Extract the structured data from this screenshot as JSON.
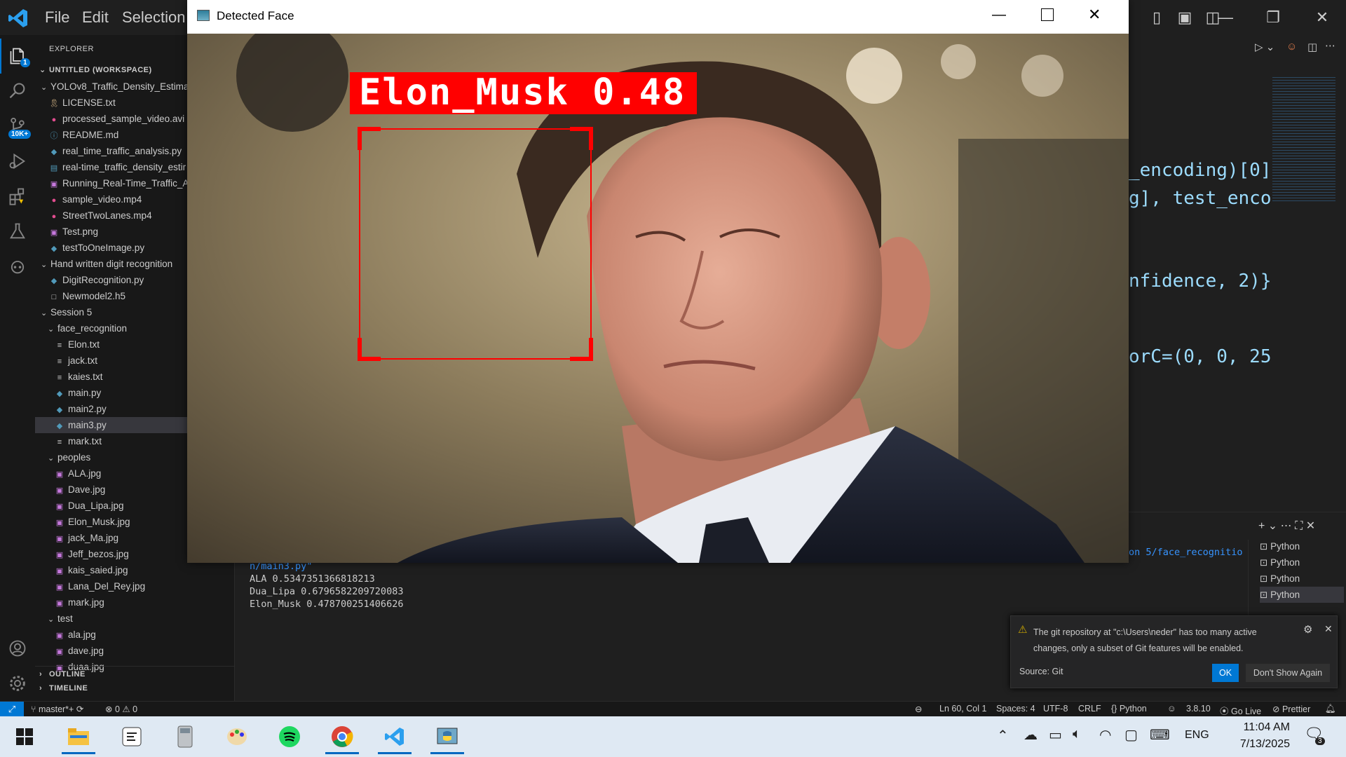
{
  "app_title": "Visual Studio Code",
  "menu": [
    "File",
    "Edit",
    "Selection"
  ],
  "sidebar": {
    "explorer_label": "EXPLORER",
    "workspace_label": "UNTITLED (WORKSPACE)",
    "items": [
      {
        "label": "YOLOv8_Traffic_Density_Estima",
        "type": "folder",
        "depth": 1,
        "icon": "chevron-down-icon"
      },
      {
        "label": "LICENSE.txt",
        "type": "file",
        "depth": 2,
        "icon": "license-icon",
        "color": "#e2c08d"
      },
      {
        "label": "processed_sample_video.avi",
        "type": "file",
        "depth": 2,
        "icon": "video-icon",
        "color": "#e24d8f"
      },
      {
        "label": "README.md",
        "type": "file",
        "depth": 2,
        "icon": "info-icon",
        "color": "#519aba"
      },
      {
        "label": "real_time_traffic_analysis.py",
        "type": "file",
        "depth": 2,
        "icon": "python-icon",
        "color": "#519aba"
      },
      {
        "label": "real-time_traffic_density_estir",
        "type": "file",
        "depth": 2,
        "icon": "notebook-icon",
        "color": "#519aba"
      },
      {
        "label": "Running_Real-Time_Traffic_A",
        "type": "file",
        "depth": 2,
        "icon": "image-icon",
        "color": "#c678dd"
      },
      {
        "label": "sample_video.mp4",
        "type": "file",
        "depth": 2,
        "icon": "video-icon",
        "color": "#e24d8f"
      },
      {
        "label": "StreetTwoLanes.mp4",
        "type": "file",
        "depth": 2,
        "icon": "video-icon",
        "color": "#e24d8f"
      },
      {
        "label": "Test.png",
        "type": "file",
        "depth": 2,
        "icon": "image-icon",
        "color": "#c678dd"
      },
      {
        "label": "testToOneImage.py",
        "type": "file",
        "depth": 2,
        "icon": "python-icon",
        "color": "#519aba"
      },
      {
        "label": "Hand written digit recognition",
        "type": "folder",
        "depth": 1,
        "icon": "chevron-down-icon"
      },
      {
        "label": "DigitRecognition.py",
        "type": "file",
        "depth": 2,
        "icon": "python-icon",
        "color": "#519aba"
      },
      {
        "label": "Newmodel2.h5",
        "type": "file",
        "depth": 2,
        "icon": "blank-icon",
        "color": "#cccccc"
      },
      {
        "label": "Session 5",
        "type": "folder",
        "depth": 1,
        "icon": "chevron-down-icon"
      },
      {
        "label": "face_recognition",
        "type": "folder",
        "depth": 2,
        "icon": "chevron-down-icon"
      },
      {
        "label": "Elon.txt",
        "type": "file",
        "depth": 3,
        "icon": "lines-icon",
        "color": "#cccccc"
      },
      {
        "label": "jack.txt",
        "type": "file",
        "depth": 3,
        "icon": "lines-icon",
        "color": "#cccccc"
      },
      {
        "label": "kaies.txt",
        "type": "file",
        "depth": 3,
        "icon": "lines-icon",
        "color": "#cccccc"
      },
      {
        "label": "main.py",
        "type": "file",
        "depth": 3,
        "icon": "python-icon",
        "color": "#519aba"
      },
      {
        "label": "main2.py",
        "type": "file",
        "depth": 3,
        "icon": "python-icon",
        "color": "#519aba"
      },
      {
        "label": "main3.py",
        "type": "file",
        "depth": 3,
        "icon": "python-icon",
        "color": "#519aba",
        "selected": true
      },
      {
        "label": "mark.txt",
        "type": "file",
        "depth": 3,
        "icon": "lines-icon",
        "color": "#cccccc"
      },
      {
        "label": "peoples",
        "type": "folder",
        "depth": 2,
        "icon": "chevron-down-icon"
      },
      {
        "label": "ALA.jpg",
        "type": "file",
        "depth": 3,
        "icon": "image-icon",
        "color": "#c678dd"
      },
      {
        "label": "Dave.jpg",
        "type": "file",
        "depth": 3,
        "icon": "image-icon",
        "color": "#c678dd"
      },
      {
        "label": "Dua_Lipa.jpg",
        "type": "file",
        "depth": 3,
        "icon": "image-icon",
        "color": "#c678dd"
      },
      {
        "label": "Elon_Musk.jpg",
        "type": "file",
        "depth": 3,
        "icon": "image-icon",
        "color": "#c678dd"
      },
      {
        "label": "jack_Ma.jpg",
        "type": "file",
        "depth": 3,
        "icon": "image-icon",
        "color": "#c678dd"
      },
      {
        "label": "Jeff_bezos.jpg",
        "type": "file",
        "depth": 3,
        "icon": "image-icon",
        "color": "#c678dd"
      },
      {
        "label": "kais_saied.jpg",
        "type": "file",
        "depth": 3,
        "icon": "image-icon",
        "color": "#c678dd"
      },
      {
        "label": "Lana_Del_Rey.jpg",
        "type": "file",
        "depth": 3,
        "icon": "image-icon",
        "color": "#c678dd"
      },
      {
        "label": "mark.jpg",
        "type": "file",
        "depth": 3,
        "icon": "image-icon",
        "color": "#c678dd"
      },
      {
        "label": "test",
        "type": "folder",
        "depth": 2,
        "icon": "chevron-down-icon"
      },
      {
        "label": "ala.jpg",
        "type": "file",
        "depth": 3,
        "icon": "image-icon",
        "color": "#c678dd"
      },
      {
        "label": "dave.jpg",
        "type": "file",
        "depth": 3,
        "icon": "image-icon",
        "color": "#c678dd"
      },
      {
        "label": "duaa.jpg",
        "type": "file",
        "depth": 3,
        "icon": "image-icon",
        "color": "#c678dd"
      }
    ],
    "outline_label": "OUTLINE",
    "timeline_label": "TIMELINE"
  },
  "code_fragments": [
    "_encoding)[0]",
    "g], test_enco",
    "nfidence, 2)}",
    "orC=(0, 0, 25"
  ],
  "terminal": {
    "path_line_1": "on 5/face_recognitio",
    "path_line_2": "n/main3.py\"",
    "output": [
      "ALA 0.5347351366818213",
      "Dua_Lipa 0.6796582209720083",
      "Elon_Musk 0.478700251406626"
    ],
    "tabs": [
      "Python",
      "Python",
      "Python",
      "Python"
    ]
  },
  "face_window": {
    "title": "Detected Face",
    "label": "Elon_Musk 0.48"
  },
  "notification": {
    "message": "The git repository at \"c:\\Users\\neder\" has too many active changes, only a subset of Git features will be enabled.",
    "source": "Source: Git",
    "ok_label": "OK",
    "dont_show_label": "Don't Show Again"
  },
  "statusbar": {
    "branch": "master*+",
    "problems": "0",
    "warnings": "0",
    "position": "Ln 60, Col 1",
    "spaces": "Spaces: 4",
    "encoding": "UTF-8",
    "eol": "CRLF",
    "language": "Python",
    "version": "3.8.10",
    "golive": "Go Live",
    "prettier": "Prettier"
  },
  "taskbar": {
    "lang": "ENG",
    "time": "11:04 AM",
    "date": "7/13/2025",
    "notification_count": "3"
  },
  "badges": {
    "source_control": "10K+",
    "explorer": "1"
  },
  "colors": {
    "accent": "#0078d4",
    "detection_red": "#ff0000"
  }
}
